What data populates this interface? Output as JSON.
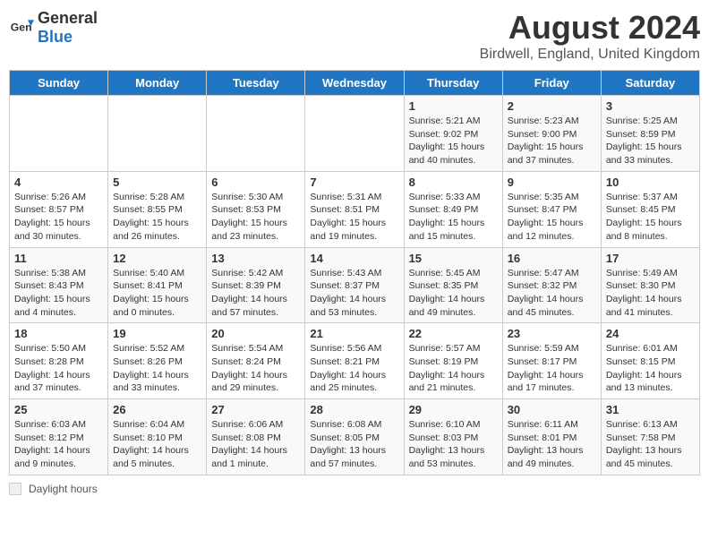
{
  "header": {
    "logo_general": "General",
    "logo_blue": "Blue",
    "title": "August 2024",
    "subtitle": "Birdwell, England, United Kingdom"
  },
  "days_of_week": [
    "Sunday",
    "Monday",
    "Tuesday",
    "Wednesday",
    "Thursday",
    "Friday",
    "Saturday"
  ],
  "weeks": [
    [
      {
        "day": "",
        "sunrise": "",
        "sunset": "",
        "daylight": ""
      },
      {
        "day": "",
        "sunrise": "",
        "sunset": "",
        "daylight": ""
      },
      {
        "day": "",
        "sunrise": "",
        "sunset": "",
        "daylight": ""
      },
      {
        "day": "",
        "sunrise": "",
        "sunset": "",
        "daylight": ""
      },
      {
        "day": "1",
        "sunrise": "Sunrise: 5:21 AM",
        "sunset": "Sunset: 9:02 PM",
        "daylight": "Daylight: 15 hours and 40 minutes."
      },
      {
        "day": "2",
        "sunrise": "Sunrise: 5:23 AM",
        "sunset": "Sunset: 9:00 PM",
        "daylight": "Daylight: 15 hours and 37 minutes."
      },
      {
        "day": "3",
        "sunrise": "Sunrise: 5:25 AM",
        "sunset": "Sunset: 8:59 PM",
        "daylight": "Daylight: 15 hours and 33 minutes."
      }
    ],
    [
      {
        "day": "4",
        "sunrise": "Sunrise: 5:26 AM",
        "sunset": "Sunset: 8:57 PM",
        "daylight": "Daylight: 15 hours and 30 minutes."
      },
      {
        "day": "5",
        "sunrise": "Sunrise: 5:28 AM",
        "sunset": "Sunset: 8:55 PM",
        "daylight": "Daylight: 15 hours and 26 minutes."
      },
      {
        "day": "6",
        "sunrise": "Sunrise: 5:30 AM",
        "sunset": "Sunset: 8:53 PM",
        "daylight": "Daylight: 15 hours and 23 minutes."
      },
      {
        "day": "7",
        "sunrise": "Sunrise: 5:31 AM",
        "sunset": "Sunset: 8:51 PM",
        "daylight": "Daylight: 15 hours and 19 minutes."
      },
      {
        "day": "8",
        "sunrise": "Sunrise: 5:33 AM",
        "sunset": "Sunset: 8:49 PM",
        "daylight": "Daylight: 15 hours and 15 minutes."
      },
      {
        "day": "9",
        "sunrise": "Sunrise: 5:35 AM",
        "sunset": "Sunset: 8:47 PM",
        "daylight": "Daylight: 15 hours and 12 minutes."
      },
      {
        "day": "10",
        "sunrise": "Sunrise: 5:37 AM",
        "sunset": "Sunset: 8:45 PM",
        "daylight": "Daylight: 15 hours and 8 minutes."
      }
    ],
    [
      {
        "day": "11",
        "sunrise": "Sunrise: 5:38 AM",
        "sunset": "Sunset: 8:43 PM",
        "daylight": "Daylight: 15 hours and 4 minutes."
      },
      {
        "day": "12",
        "sunrise": "Sunrise: 5:40 AM",
        "sunset": "Sunset: 8:41 PM",
        "daylight": "Daylight: 15 hours and 0 minutes."
      },
      {
        "day": "13",
        "sunrise": "Sunrise: 5:42 AM",
        "sunset": "Sunset: 8:39 PM",
        "daylight": "Daylight: 14 hours and 57 minutes."
      },
      {
        "day": "14",
        "sunrise": "Sunrise: 5:43 AM",
        "sunset": "Sunset: 8:37 PM",
        "daylight": "Daylight: 14 hours and 53 minutes."
      },
      {
        "day": "15",
        "sunrise": "Sunrise: 5:45 AM",
        "sunset": "Sunset: 8:35 PM",
        "daylight": "Daylight: 14 hours and 49 minutes."
      },
      {
        "day": "16",
        "sunrise": "Sunrise: 5:47 AM",
        "sunset": "Sunset: 8:32 PM",
        "daylight": "Daylight: 14 hours and 45 minutes."
      },
      {
        "day": "17",
        "sunrise": "Sunrise: 5:49 AM",
        "sunset": "Sunset: 8:30 PM",
        "daylight": "Daylight: 14 hours and 41 minutes."
      }
    ],
    [
      {
        "day": "18",
        "sunrise": "Sunrise: 5:50 AM",
        "sunset": "Sunset: 8:28 PM",
        "daylight": "Daylight: 14 hours and 37 minutes."
      },
      {
        "day": "19",
        "sunrise": "Sunrise: 5:52 AM",
        "sunset": "Sunset: 8:26 PM",
        "daylight": "Daylight: 14 hours and 33 minutes."
      },
      {
        "day": "20",
        "sunrise": "Sunrise: 5:54 AM",
        "sunset": "Sunset: 8:24 PM",
        "daylight": "Daylight: 14 hours and 29 minutes."
      },
      {
        "day": "21",
        "sunrise": "Sunrise: 5:56 AM",
        "sunset": "Sunset: 8:21 PM",
        "daylight": "Daylight: 14 hours and 25 minutes."
      },
      {
        "day": "22",
        "sunrise": "Sunrise: 5:57 AM",
        "sunset": "Sunset: 8:19 PM",
        "daylight": "Daylight: 14 hours and 21 minutes."
      },
      {
        "day": "23",
        "sunrise": "Sunrise: 5:59 AM",
        "sunset": "Sunset: 8:17 PM",
        "daylight": "Daylight: 14 hours and 17 minutes."
      },
      {
        "day": "24",
        "sunrise": "Sunrise: 6:01 AM",
        "sunset": "Sunset: 8:15 PM",
        "daylight": "Daylight: 14 hours and 13 minutes."
      }
    ],
    [
      {
        "day": "25",
        "sunrise": "Sunrise: 6:03 AM",
        "sunset": "Sunset: 8:12 PM",
        "daylight": "Daylight: 14 hours and 9 minutes."
      },
      {
        "day": "26",
        "sunrise": "Sunrise: 6:04 AM",
        "sunset": "Sunset: 8:10 PM",
        "daylight": "Daylight: 14 hours and 5 minutes."
      },
      {
        "day": "27",
        "sunrise": "Sunrise: 6:06 AM",
        "sunset": "Sunset: 8:08 PM",
        "daylight": "Daylight: 14 hours and 1 minute."
      },
      {
        "day": "28",
        "sunrise": "Sunrise: 6:08 AM",
        "sunset": "Sunset: 8:05 PM",
        "daylight": "Daylight: 13 hours and 57 minutes."
      },
      {
        "day": "29",
        "sunrise": "Sunrise: 6:10 AM",
        "sunset": "Sunset: 8:03 PM",
        "daylight": "Daylight: 13 hours and 53 minutes."
      },
      {
        "day": "30",
        "sunrise": "Sunrise: 6:11 AM",
        "sunset": "Sunset: 8:01 PM",
        "daylight": "Daylight: 13 hours and 49 minutes."
      },
      {
        "day": "31",
        "sunrise": "Sunrise: 6:13 AM",
        "sunset": "Sunset: 7:58 PM",
        "daylight": "Daylight: 13 hours and 45 minutes."
      }
    ]
  ],
  "legend": {
    "text": "Daylight hours"
  }
}
